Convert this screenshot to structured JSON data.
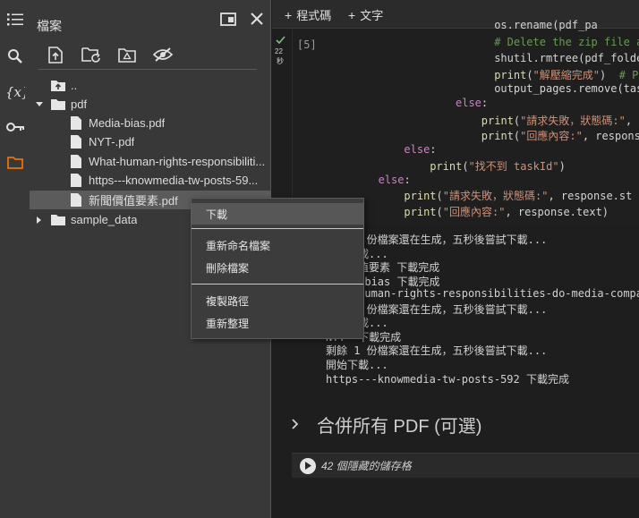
{
  "panel": {
    "title": "檔案",
    "tree": [
      {
        "label": "..",
        "type": "up"
      },
      {
        "label": "pdf",
        "type": "folder-open"
      },
      {
        "label": "Media-bias.pdf",
        "type": "file"
      },
      {
        "label": "NYT-.pdf",
        "type": "file"
      },
      {
        "label": "What-human-rights-responsibiliti...",
        "type": "file"
      },
      {
        "label": "https---knowmedia-tw-posts-59...",
        "type": "file"
      },
      {
        "label": "新聞價值要素.pdf",
        "type": "file",
        "selected": true
      },
      {
        "label": "sample_data",
        "type": "folder-closed"
      }
    ]
  },
  "topbar": {
    "add_code": "程式碼",
    "add_text": "文字"
  },
  "cell": {
    "number": "[5]",
    "exec_time": "22",
    "exec_unit": "秒",
    "lines": [
      {
        "indent": 31,
        "parts": [
          {
            "t": "os.rename(pdf_pa",
            "c": ""
          }
        ]
      },
      {
        "indent": 31,
        "parts": [
          {
            "t": "# Delete the zip file an",
            "c": "cm"
          }
        ]
      },
      {
        "indent": 31,
        "parts": [
          {
            "t": "shutil.rmtree(pdf_folder",
            "c": ""
          }
        ]
      },
      {
        "indent": 31,
        "parts": [
          {
            "t": "print",
            "c": "fn"
          },
          {
            "t": "(",
            "c": ""
          },
          {
            "t": "\"解壓縮完成\"",
            "c": "st"
          },
          {
            "t": ")  ",
            "c": ""
          },
          {
            "t": "# P",
            "c": "cm"
          }
        ]
      },
      {
        "indent": 31,
        "parts": [
          {
            "t": "output_pages.remove(task",
            "c": ""
          }
        ]
      },
      {
        "indent": 25,
        "parts": [
          {
            "t": "else",
            "c": "kw"
          },
          {
            "t": ":",
            "c": ""
          }
        ]
      },
      {
        "indent": 29,
        "parts": [
          {
            "t": "print",
            "c": "fn"
          },
          {
            "t": "(",
            "c": ""
          },
          {
            "t": "\"請求失敗，狀態碼:\"",
            "c": "st"
          },
          {
            "t": ",",
            "c": ""
          }
        ]
      },
      {
        "indent": 29,
        "parts": [
          {
            "t": "print",
            "c": "fn"
          },
          {
            "t": "(",
            "c": ""
          },
          {
            "t": "\"回應內容:\"",
            "c": "st"
          },
          {
            "t": ", respons",
            "c": ""
          }
        ]
      },
      {
        "indent": 17,
        "parts": [
          {
            "t": "else",
            "c": "kw"
          },
          {
            "t": ":",
            "c": ""
          }
        ]
      },
      {
        "indent": 21,
        "parts": [
          {
            "t": "print",
            "c": "fn"
          },
          {
            "t": "(",
            "c": ""
          },
          {
            "t": "\"找不到 taskId\"",
            "c": "st"
          },
          {
            "t": ")",
            "c": ""
          }
        ]
      },
      {
        "indent": 13,
        "parts": [
          {
            "t": "else",
            "c": "kw"
          },
          {
            "t": ":",
            "c": ""
          }
        ]
      },
      {
        "indent": 17,
        "parts": [
          {
            "t": "print",
            "c": "fn"
          },
          {
            "t": "(",
            "c": ""
          },
          {
            "t": "\"請求失敗，狀態碼:\"",
            "c": "st"
          },
          {
            "t": ", response.st",
            "c": ""
          }
        ]
      },
      {
        "indent": 17,
        "parts": [
          {
            "t": "print",
            "c": "fn"
          },
          {
            "t": "(",
            "c": ""
          },
          {
            "t": "\"回應內容:\"",
            "c": "st"
          },
          {
            "t": ", response.text)",
            "c": ""
          }
        ]
      }
    ]
  },
  "output": [
    "剩餘 1 份檔案還在生成，五秒後嘗試下載...",
    "開始下載...",
    "新聞價值要素 下載完成",
    "Media-bias 下載完成",
    "What-human-rights-responsibilities-do-media-compan",
    "剩餘 1 份檔案還在生成，五秒後嘗試下載...",
    "開始下載...",
    "NYT- 下載完成",
    "剩餘 1 份檔案還在生成，五秒後嘗試下載...",
    "開始下載...",
    "https---knowmedia-tw-posts-592 下載完成"
  ],
  "section": {
    "title": "合併所有 PDF (可選)",
    "hidden_cells": "42 個隱藏的儲存格"
  },
  "context_menu": {
    "items": [
      "下載",
      "重新命名檔案",
      "刪除檔案",
      "複製路徑",
      "重新整理"
    ]
  },
  "colors": {
    "accent_orange": "#e8710a",
    "check_green": "#7fbf7f"
  }
}
